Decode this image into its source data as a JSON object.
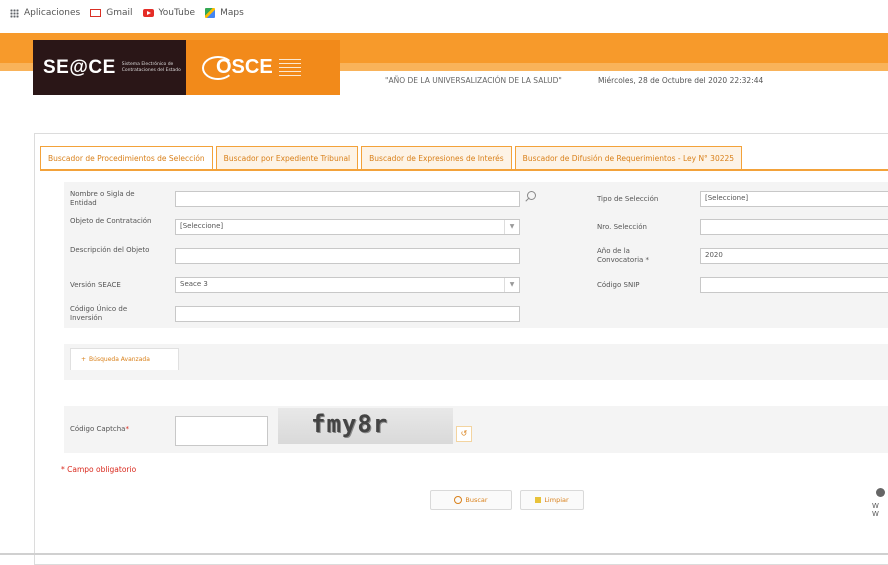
{
  "bookmarks": [
    {
      "label": "Aplicaciones",
      "icon": "apps-icon"
    },
    {
      "label": "Gmail",
      "icon": "gmail-icon"
    },
    {
      "label": "YouTube",
      "icon": "youtube-icon"
    },
    {
      "label": "Maps",
      "icon": "maps-icon"
    }
  ],
  "header": {
    "seace_logo": "SE@CE",
    "seace_subtitle": "Sistema Electrónico de Contrataciones del Estado",
    "osce_logo": "OSCE",
    "motto": "\"AÑO DE LA UNIVERSALIZACIÓN DE LA SALUD\"",
    "datetime": "Miércoles, 28 de Octubre del 2020 22:32:44",
    "brand_color": "#f79a2b"
  },
  "tabs": [
    {
      "label": "Buscador de Procedimientos de Selección",
      "active": true
    },
    {
      "label": "Buscador por Expediente Tribunal",
      "active": false
    },
    {
      "label": "Buscador de Expresiones de Interés",
      "active": false
    },
    {
      "label": "Buscador de Difusión de Requerimientos - Ley N° 30225",
      "active": false
    }
  ],
  "form": {
    "entity_label": "Nombre o Sigla de Entidad",
    "entity_value": "",
    "dept_label": "Objeto de Contratación",
    "dept_value": "[Seleccione]",
    "desc_label": "Descripción del Objeto",
    "desc_value": "",
    "version_label": "Versión SEACE",
    "version_value": "Seace 3",
    "code_label": "Código Único de Inversión",
    "code_value": "",
    "tipo_label": "Tipo de Selección",
    "tipo_value": "[Seleccione]",
    "nro_label": "Nro. Selección",
    "nro_value": "",
    "year_label": "Año de la Convocatoria *",
    "year_value": "2020",
    "snip_label": "Código SNIP",
    "snip_value": ""
  },
  "advanced": {
    "label": "Búsqueda Avanzada"
  },
  "captcha": {
    "label": "Código Captcha",
    "required_mark": "*",
    "image_text": "fmy8r",
    "refresh_glyph": "↺"
  },
  "required_note": "* Campo obligatorio",
  "buttons": {
    "search": "Buscar",
    "clear": "Limpiar"
  },
  "side_widget": {
    "line1": "W",
    "line2": "W"
  }
}
